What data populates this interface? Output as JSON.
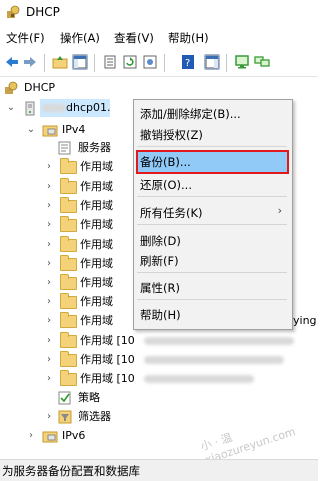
{
  "window": {
    "title": "DHCP"
  },
  "menubar": {
    "items": [
      "文件(F)",
      "操作(A)",
      "查看(V)",
      "帮助(H)"
    ]
  },
  "toolbar": {
    "icons": [
      "back-arrow-icon",
      "forward-arrow-icon",
      "up-folder-icon",
      "show-hide-tree-icon",
      "export-list-icon",
      "refresh-icon",
      "properties-icon",
      "help-icon",
      "console-icon",
      "monitor-icon",
      "network-icon"
    ]
  },
  "tree": {
    "root": "DHCP",
    "server": "dhcp01.",
    "ipv4": "IPv4",
    "server_options": "服务器",
    "scope_label": "作用域",
    "scope_prefix": "作用域 [10",
    "trailing_text": "ying",
    "policies": "策略",
    "filters": "筛选器",
    "ipv6": "IPv6"
  },
  "context_menu": {
    "add_remove_bindings": "添加/删除绑定(B)...",
    "unauthorize": "撤销授权(Z)",
    "backup": "备份(B)...",
    "restore": "还原(O)...",
    "all_tasks": "所有任务(K)",
    "delete": "删除(D)",
    "refresh": "刷新(F)",
    "properties": "属性(R)",
    "help": "帮助(H)",
    "highlight_color": "#91c9f7",
    "callout_color": "#e0191d"
  },
  "statusbar": {
    "text": "为服务器备份配置和数据库"
  },
  "watermark": {
    "text": "小 · 温  xiaozureyun.com"
  }
}
